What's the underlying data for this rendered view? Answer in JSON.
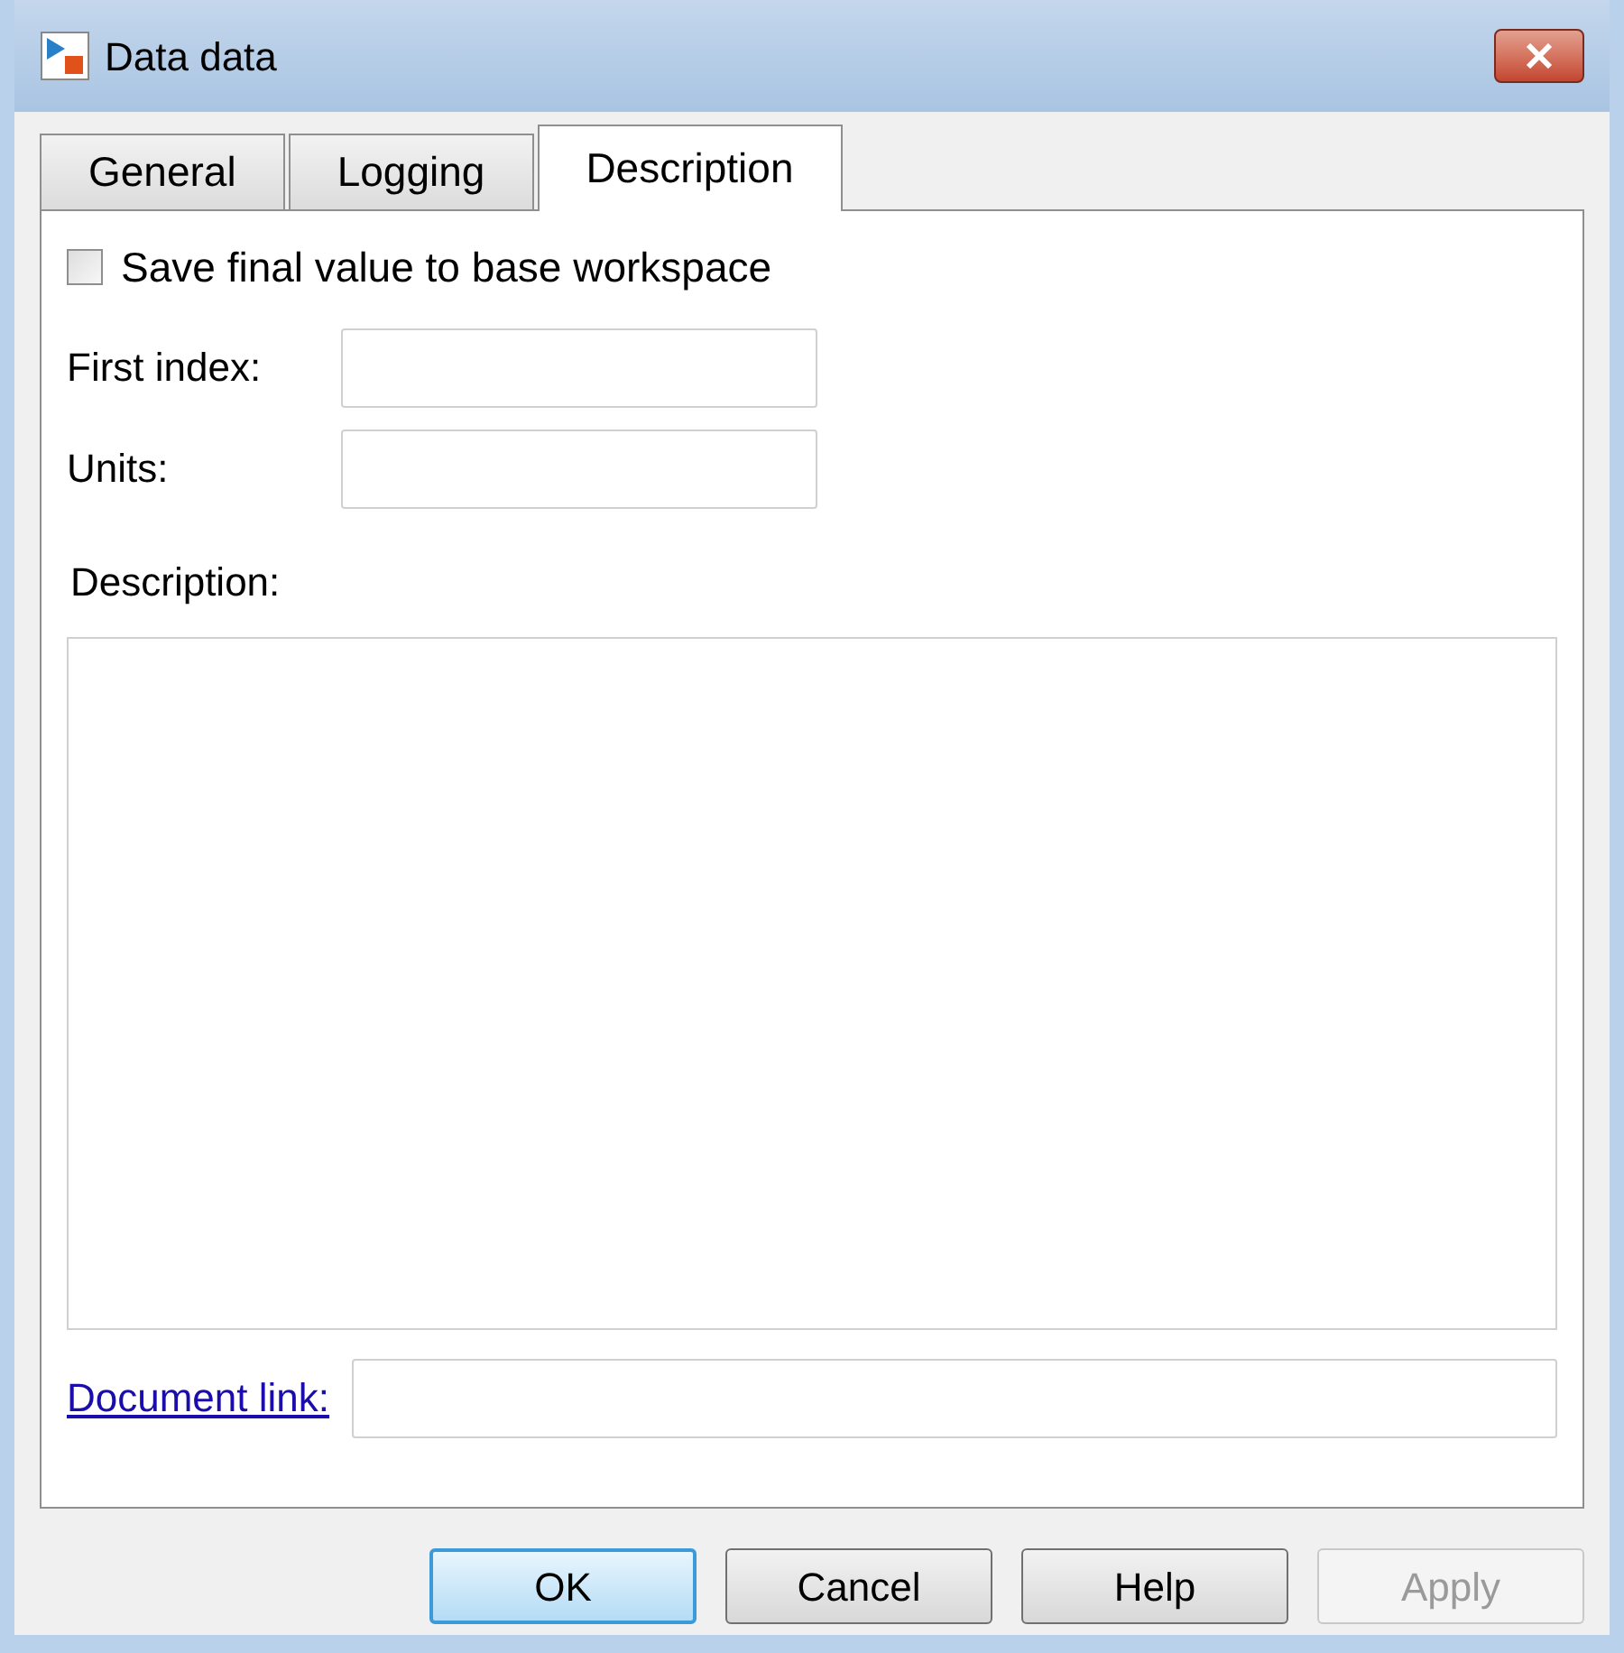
{
  "window": {
    "title": "Data data"
  },
  "tabs": [
    {
      "label": "General",
      "selected": false
    },
    {
      "label": "Logging",
      "selected": false
    },
    {
      "label": "Description",
      "selected": true
    }
  ],
  "save_checkbox": {
    "label": "Save final value to base workspace",
    "checked": false
  },
  "fields": [
    {
      "label": "First index:"
    },
    {
      "label": "Units:"
    }
  ],
  "description": {
    "label": "Description:"
  },
  "document_link": {
    "label": "Document link:"
  },
  "buttons": [
    {
      "label": "OK",
      "default": true,
      "disabled": false
    },
    {
      "label": "Cancel",
      "default": false,
      "disabled": false
    },
    {
      "label": "Help",
      "default": false,
      "disabled": false
    },
    {
      "label": "Apply",
      "default": false,
      "disabled": true
    }
  ]
}
